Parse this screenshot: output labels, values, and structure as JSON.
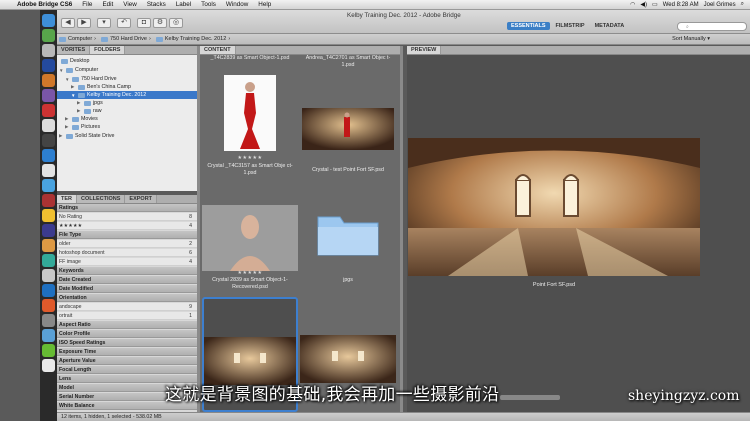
{
  "menubar": {
    "app": "Adobe Bridge CS6",
    "items": [
      "File",
      "Edit",
      "View",
      "Stacks",
      "Label",
      "Tools",
      "Window",
      "Help"
    ],
    "clock": "Wed 8:28 AM",
    "user": "Joel Grimes"
  },
  "window": {
    "title": "Kelby Training Dec. 2012 - Adobe Bridge"
  },
  "workspaces": {
    "items": [
      "ESSENTIALS",
      "FILMSTRIP",
      "METADATA"
    ],
    "active": "ESSENTIALS"
  },
  "path": {
    "items": [
      "Computer",
      "750 Hard Drive",
      "Kelby Training Dec. 2012"
    ]
  },
  "sort": {
    "label": "Sort Manually"
  },
  "left_tabs": {
    "fav": "VORITES",
    "folders": "FOLDERS"
  },
  "folders": {
    "items": [
      {
        "label": "Desktop"
      },
      {
        "label": "Computer"
      },
      {
        "label": "750 Hard Drive"
      },
      {
        "label": "Ben's China Camp"
      },
      {
        "label": "Kelby Training Dec. 2012"
      },
      {
        "label": "jpgs"
      },
      {
        "label": "raw"
      },
      {
        "label": "Movies"
      },
      {
        "label": "Pictures"
      },
      {
        "label": "Solid State Drive"
      }
    ]
  },
  "filter_tabs": {
    "filter": "TER",
    "collections": "COLLECTIONS",
    "export": "EXPORT"
  },
  "filter": {
    "rows": [
      {
        "label": "Ratings",
        "kind": "h",
        "count": ""
      },
      {
        "label": "No Rating",
        "kind": "i",
        "count": "8"
      },
      {
        "label": "★★★★★",
        "kind": "i",
        "count": "4"
      },
      {
        "label": "File Type",
        "kind": "h",
        "count": ""
      },
      {
        "label": "older",
        "kind": "i",
        "count": "2"
      },
      {
        "label": "hotoshop document",
        "kind": "i",
        "count": "6"
      },
      {
        "label": "FF image",
        "kind": "i",
        "count": "4"
      },
      {
        "label": "Keywords",
        "kind": "h",
        "count": ""
      },
      {
        "label": "Date Created",
        "kind": "h",
        "count": ""
      },
      {
        "label": "Date Modified",
        "kind": "h",
        "count": ""
      },
      {
        "label": "Orientation",
        "kind": "h",
        "count": ""
      },
      {
        "label": "andscape",
        "kind": "i",
        "count": "9"
      },
      {
        "label": "ortrait",
        "kind": "i",
        "count": "1"
      },
      {
        "label": "Aspect Ratio",
        "kind": "h",
        "count": ""
      },
      {
        "label": "Color Profile",
        "kind": "h",
        "count": ""
      },
      {
        "label": "ISO Speed Ratings",
        "kind": "h",
        "count": ""
      },
      {
        "label": "Exposure Time",
        "kind": "h",
        "count": ""
      },
      {
        "label": "Aperture Value",
        "kind": "h",
        "count": ""
      },
      {
        "label": "Focal Length",
        "kind": "h",
        "count": ""
      },
      {
        "label": "Lens",
        "kind": "h",
        "count": ""
      },
      {
        "label": "Model",
        "kind": "h",
        "count": ""
      },
      {
        "label": "Serial Number",
        "kind": "h",
        "count": ""
      },
      {
        "label": "White Balance",
        "kind": "h",
        "count": ""
      }
    ]
  },
  "content": {
    "tab": "CONTENT",
    "top_captions": [
      "_T4C2839 as Smart Object-1.psd",
      "Andrea_T4C2701 as Smart Objec t-1.psd"
    ],
    "items": [
      {
        "caption": "Crystal _T4C3157 as Smart Obje ct-1.psd",
        "stars": "★★★★★"
      },
      {
        "caption": "Crystal - test Point Fort SF.psd",
        "stars": ""
      },
      {
        "caption": "Crystal 2839 as Smart Object-1-Recovered.psd",
        "stars": "★★★★★"
      },
      {
        "caption": "jpgs",
        "stars": ""
      }
    ]
  },
  "preview": {
    "tab": "PREVIEW",
    "caption": "Point Fort SF.psd"
  },
  "status": {
    "text": "12 items, 1 hidden, 1 selected - 538.02 MB"
  },
  "overlay": {
    "subtitle": "这就是背景图的基础,我会再加一些摄影前沿",
    "watermark": "sheyingzyz.com"
  }
}
